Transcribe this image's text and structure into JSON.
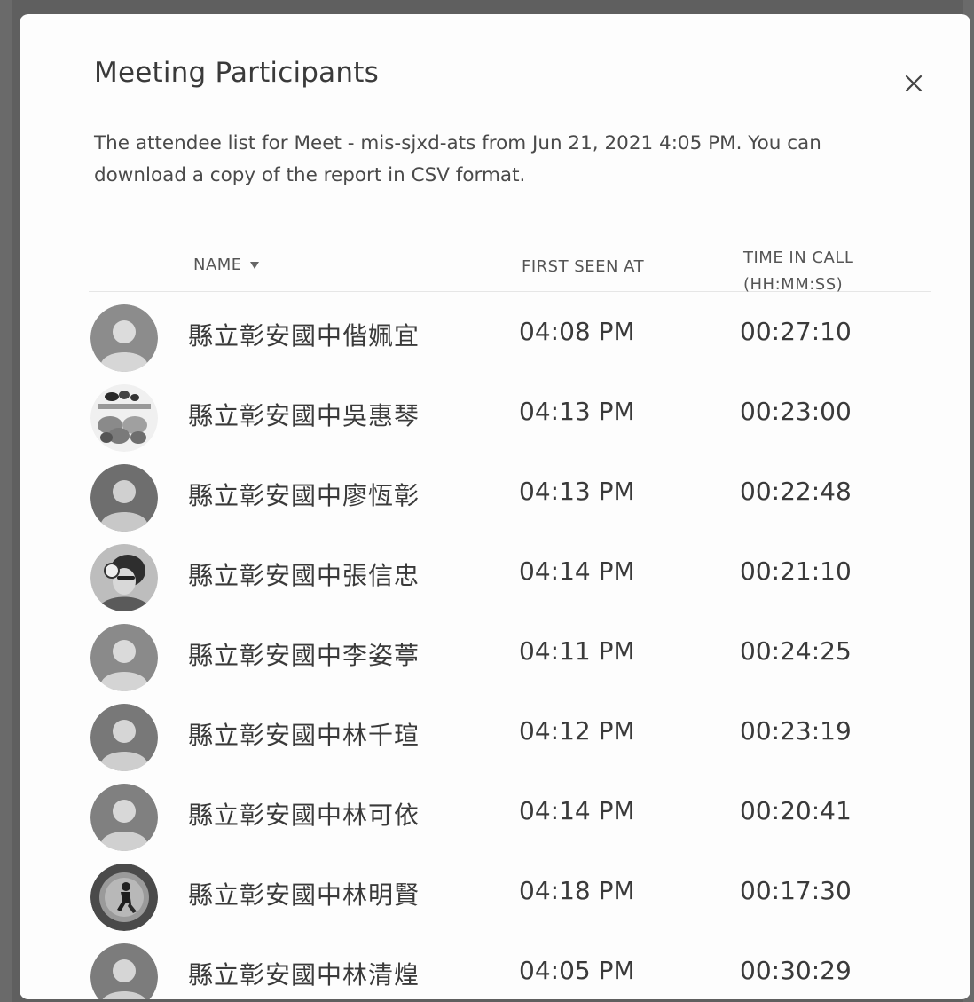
{
  "dialog": {
    "title": "Meeting Participants",
    "description_line1": "The attendee list for Meet - mis-sjxd-ats from Jun 21, 2021 4:05 PM. You can",
    "description_line2": "download a copy of the report in CSV format.",
    "close_icon": "close-icon"
  },
  "table": {
    "headers": {
      "name": "NAME",
      "name_sort_icon": "sort-down-icon",
      "first_seen": "FIRST SEEN AT",
      "time_in_call_line1": "TIME IN CALL",
      "time_in_call_line2": "(HH:MM:SS)"
    },
    "rows": [
      {
        "name": "縣立彰安國中偕姵宜",
        "first_seen": "04:08 PM",
        "time_in_call": "00:27:10",
        "avatar": "default-avatar-icon"
      },
      {
        "name": "縣立彰安國中吳惠琴",
        "first_seen": "04:13 PM",
        "time_in_call": "00:23:00",
        "avatar": "photo-avatar"
      },
      {
        "name": "縣立彰安國中廖恆彰",
        "first_seen": "04:13 PM",
        "time_in_call": "00:22:48",
        "avatar": "default-avatar-icon"
      },
      {
        "name": "縣立彰安國中張信忠",
        "first_seen": "04:14 PM",
        "time_in_call": "00:21:10",
        "avatar": "photo-avatar"
      },
      {
        "name": "縣立彰安國中李姿葶",
        "first_seen": "04:11 PM",
        "time_in_call": "00:24:25",
        "avatar": "default-avatar-icon"
      },
      {
        "name": "縣立彰安國中林千瑄",
        "first_seen": "04:12 PM",
        "time_in_call": "00:23:19",
        "avatar": "default-avatar-icon"
      },
      {
        "name": "縣立彰安國中林可依",
        "first_seen": "04:14 PM",
        "time_in_call": "00:20:41",
        "avatar": "default-avatar-icon"
      },
      {
        "name": "縣立彰安國中林明賢",
        "first_seen": "04:18 PM",
        "time_in_call": "00:17:30",
        "avatar": "photo-avatar"
      },
      {
        "name": "縣立彰安國中林清煌",
        "first_seen": "04:05 PM",
        "time_in_call": "00:30:29",
        "avatar": "default-avatar-icon"
      }
    ]
  }
}
